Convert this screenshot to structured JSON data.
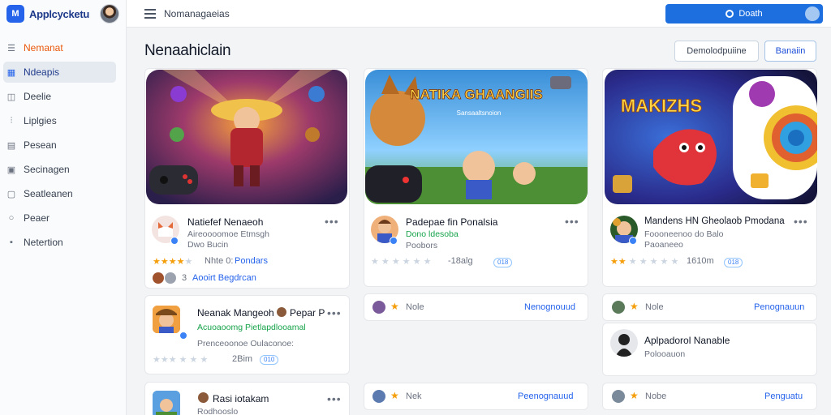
{
  "app": {
    "name": "Applcycketu",
    "logo_text": "M"
  },
  "sidebar": {
    "items": [
      {
        "label": "Nemanat",
        "icon": "list-icon"
      },
      {
        "label": "Ndeapis",
        "icon": "grid-icon"
      },
      {
        "label": "Deelie",
        "icon": "bag-icon"
      },
      {
        "label": "Liplgies",
        "icon": "chart-icon"
      },
      {
        "label": "Pesean",
        "icon": "table-icon"
      },
      {
        "label": "Secinagen",
        "icon": "image-icon"
      },
      {
        "label": "Seatleanen",
        "icon": "chat-icon"
      },
      {
        "label": "Peaer",
        "icon": "search-icon"
      },
      {
        "label": "Netertion",
        "icon": "doc-icon"
      }
    ]
  },
  "topbar": {
    "title": "Nomanagaeias",
    "search_label": "Doath"
  },
  "main": {
    "title": "Nenaahiclain",
    "btn_secondary": "Demolodpuiine",
    "btn_primary": "Banaiin"
  },
  "featured": [
    {
      "hero_title": "",
      "name": "Natiefef Nenaeoh",
      "sub1": "Aireoooomoe Etmsgh",
      "sub2": "Dwo Bucin",
      "stars_on": 4,
      "meta": "Nhte 0:",
      "meta_link": "Pondars",
      "footer": "Aooirt Begdrcan",
      "footer_prefix": "3"
    },
    {
      "hero_title": "NATIKA GHAANGIIS",
      "hero_sub": "Sansaaltsnoion",
      "name": "Padepae fin Ponalsia",
      "sub1": "Dono ldesoba",
      "sub2": "Poobors",
      "stars_on": 0,
      "meta": "-18alg",
      "pill": "018"
    },
    {
      "hero_title": "MAKIZHS",
      "name": "Mandens HN Gheolaob Pmodana",
      "sub1": "Foooneenoo do Balo",
      "sub2": "Paoaneeo",
      "stars_on": 2,
      "meta": "1610m",
      "pill": "018"
    }
  ],
  "apps": [
    {
      "name": "Neanak Mangeoh",
      "name_tail": "Pepar P",
      "sub1": "Acuoaoomg Pietlapdlooamal",
      "sub2": "Prenceoonoe Oulaconoe:",
      "meta": "2Bim",
      "pill": "010"
    },
    {
      "name": "Rasi iotakam",
      "sub1": "Rodhooslo"
    }
  ],
  "rows_mid": [
    {
      "label": "Nole",
      "link": "Nenognouud"
    },
    {
      "label": "Nek",
      "link": "Peenognauud"
    }
  ],
  "rows_right": [
    {
      "label": "Nole",
      "link": "Penognauun"
    },
    {
      "label": "Nobe",
      "link": "Penguatu"
    }
  ],
  "detail_card": {
    "name": "Aplpadorol Nanable",
    "sub": "Polooauon"
  }
}
